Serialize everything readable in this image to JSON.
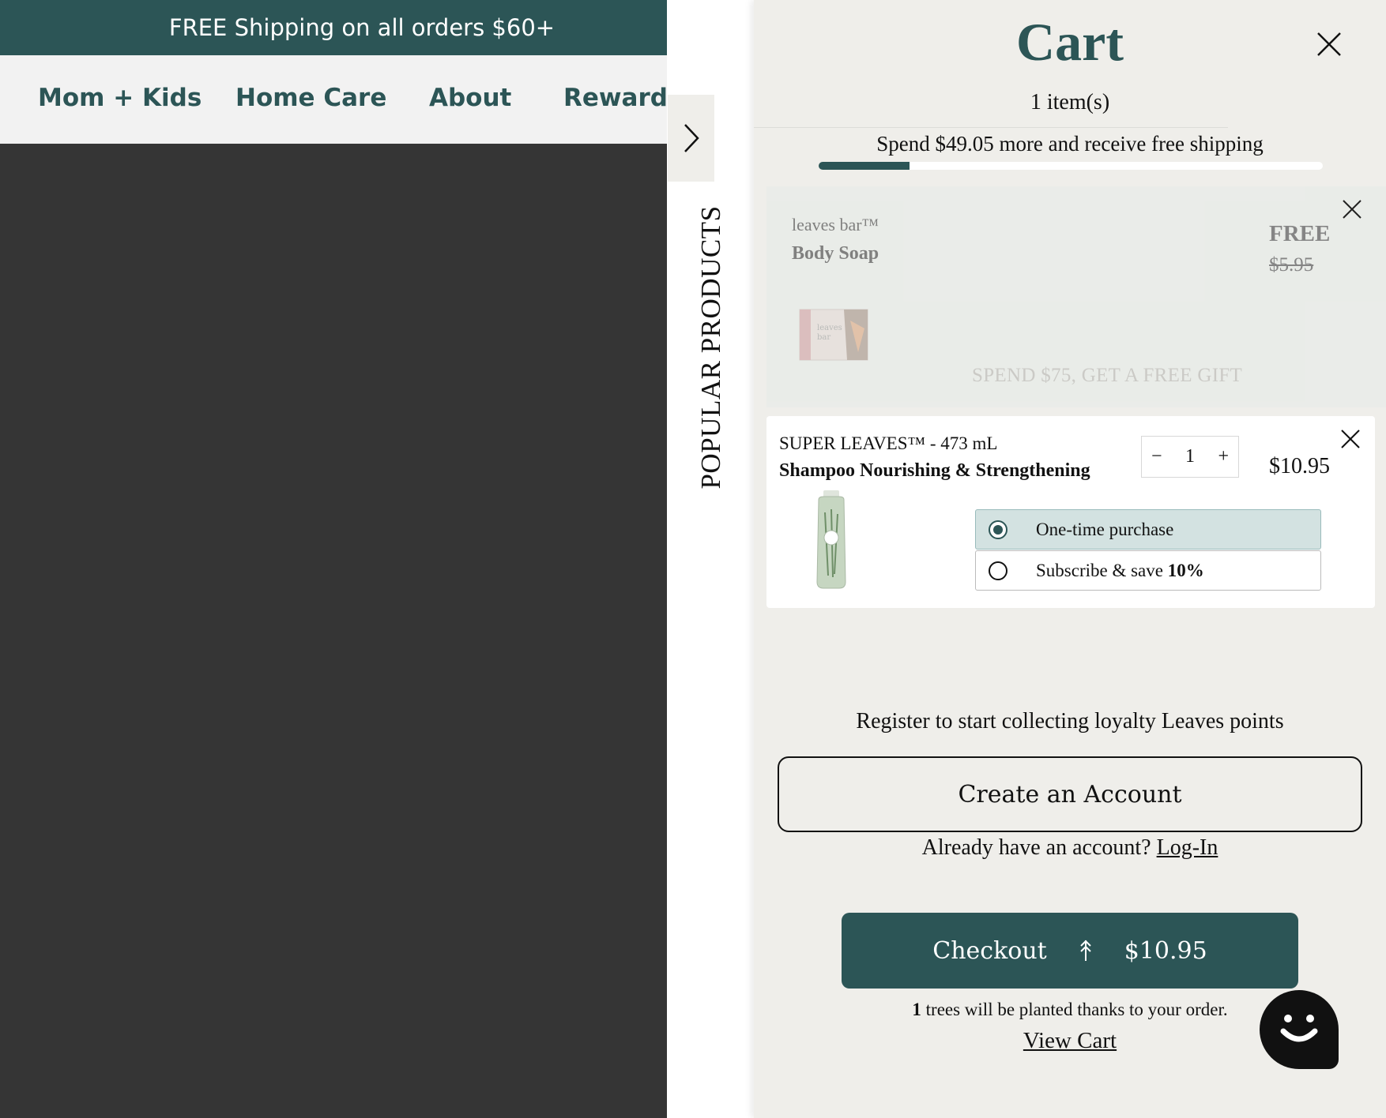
{
  "promo": {
    "text": "FREE Shipping on all orders $60+"
  },
  "nav": {
    "items": [
      "Mom + Kids",
      "Home Care",
      "About",
      "Rewards"
    ]
  },
  "popular": {
    "label": "POPULAR PRODUCTS"
  },
  "cart": {
    "title": "Cart",
    "count": "1 item(s)",
    "shipping_message": "Spend $49.05 more and receive free shipping",
    "shipping_progress": 0.18,
    "gift": {
      "brand": "leaves bar™",
      "name": "Body Soap",
      "price": "FREE",
      "original_price": "$5.95",
      "promo": "SPEND $75, GET A FREE GIFT"
    },
    "item": {
      "brand": "SUPER LEAVES™  - 473 mL",
      "name": "Shampoo Nourishing & Strengthening",
      "quantity": "1",
      "price": "$10.95",
      "options": {
        "one_time": "One-time purchase",
        "subscribe_prefix": "Subscribe & save ",
        "subscribe_discount": "10%"
      },
      "selected_option": "one_time"
    },
    "loyalty_text": "Register to start collecting loyalty Leaves points",
    "create_account_label": "Create an Account",
    "login_prompt": "Already have an account? ",
    "login_link": "Log-In",
    "checkout": {
      "label": "Checkout",
      "total": "$10.95"
    },
    "trees": {
      "count": "1",
      "text": " trees will be planted thanks to your order."
    },
    "view_cart_label": "View Cart"
  },
  "colors": {
    "brand": "#2c5556",
    "cart_bg": "#efeeea",
    "overlay": "#353535"
  },
  "icons": [
    "close-icon",
    "chevron-right-icon",
    "minus-icon",
    "plus-icon",
    "tree-icon",
    "chat-smiley-icon"
  ]
}
